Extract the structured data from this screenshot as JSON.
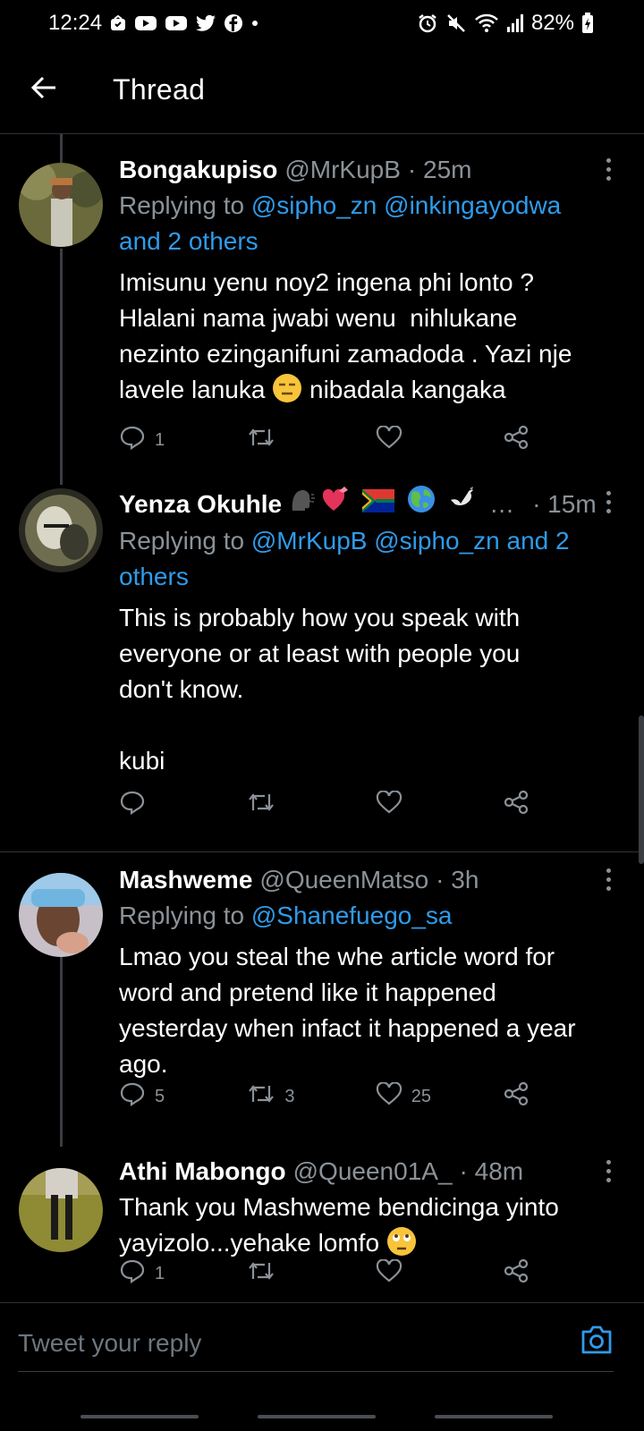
{
  "status_bar": {
    "time": "12:24",
    "battery": "82%",
    "icons_left": [
      "notification-icon",
      "youtube-icon",
      "youtube-icon",
      "twitter-icon",
      "facebook-icon",
      "dot-icon"
    ],
    "icons_right": [
      "alarm-icon",
      "mute-icon",
      "wifi-icon",
      "signal-icon",
      "battery-icon"
    ]
  },
  "header": {
    "title": "Thread",
    "back_icon": "arrow-left-icon"
  },
  "tweets": [
    {
      "name": "Bongakupiso",
      "handle": "@MrKupB",
      "time": "· 25m",
      "replying_prefix": "Replying to ",
      "replying_links": "@sipho_zn @inkingayodwa",
      "replying_tail": "and 2 others",
      "text": "Imisunu yenu noy2 ingena phi lonto ?\nHlalani nama jwabi wenu  nihlukane\nnezinto ezinganifuni zamadoda . Yazi nje\nlavele lanuka",
      "text_after_emoji": " nibadala kangaka",
      "emoji": "expressionless-face",
      "replies": "1",
      "retweets": "",
      "likes": ""
    },
    {
      "name": "Yenza Okuhle",
      "handle": "…",
      "time": "· 15m",
      "name_emojis": [
        "speaking-head",
        "heart-with-ribbon",
        "south-africa-flag",
        "globe",
        "dove"
      ],
      "replying_prefix": "Replying to ",
      "replying_links": "@MrKupB @sipho_zn and 2",
      "replying_tail": "others",
      "text": "This is probably how you speak with\neveryone or at least with people you\ndon't know.\n\nkubi",
      "replies": "",
      "retweets": "",
      "likes": ""
    },
    {
      "name": "Mashweme",
      "handle": "@QueenMatso",
      "time": "· 3h",
      "replying_prefix": "Replying to ",
      "replying_links": "@Shanefuego_sa",
      "replying_tail": "",
      "text": "Lmao you steal the whe article word for\nword and pretend like it happened\nyesterday when infact it happened a year\nago.",
      "replies": "5",
      "retweets": "3",
      "likes": "25"
    },
    {
      "name": "Athi Mabongo",
      "handle": "@Queen01A_",
      "time": "· 48m",
      "text": "Thank you Mashweme bendicinga yinto\nyayizolo...yehake lomfo",
      "emoji": "face-with-rolling-eyes",
      "replies": "1",
      "retweets": "",
      "likes": ""
    }
  ],
  "reply_bar": {
    "placeholder": "Tweet your reply",
    "camera_icon": "camera-icon"
  },
  "colors": {
    "background": "#000000",
    "accent": "#2f9beb",
    "muted": "#8b9298",
    "divider": "#2f3336"
  }
}
